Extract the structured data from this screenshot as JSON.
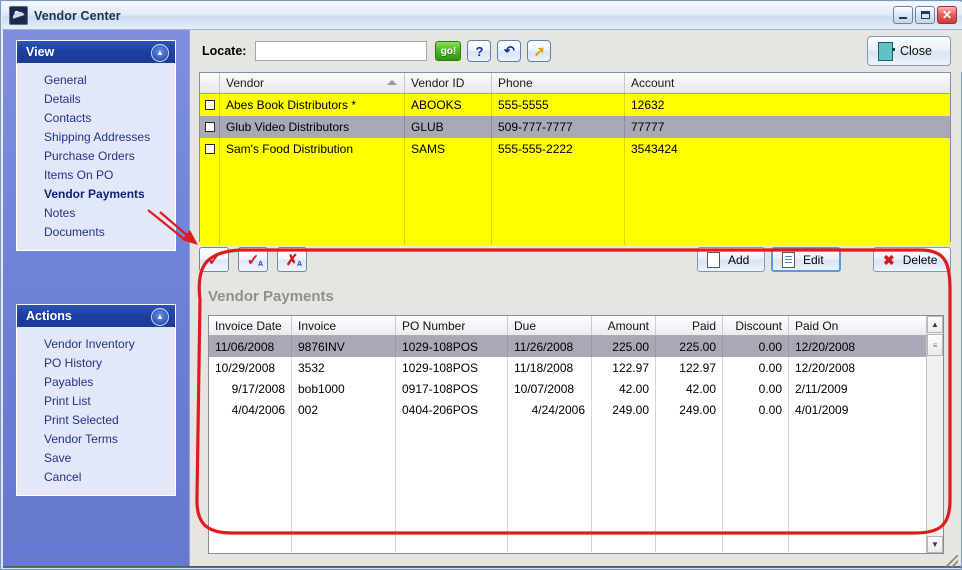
{
  "window": {
    "title": "Vendor Center",
    "icon": "app-swoosh-icon",
    "minimize_label": "_",
    "maximize_label": "□",
    "close_label": "✕"
  },
  "sidebar": {
    "groups": [
      {
        "title": "View",
        "collapse_icon": "chevron-up-icon",
        "items": [
          {
            "label": "General",
            "selected": false
          },
          {
            "label": "Details",
            "selected": false
          },
          {
            "label": "Contacts",
            "selected": false
          },
          {
            "label": "Shipping Addresses",
            "selected": false
          },
          {
            "label": "Purchase Orders",
            "selected": false
          },
          {
            "label": "Items On PO",
            "selected": false
          },
          {
            "label": "Vendor Payments",
            "selected": true
          },
          {
            "label": "Notes",
            "selected": false
          },
          {
            "label": "Documents",
            "selected": false
          }
        ]
      },
      {
        "title": "Actions",
        "collapse_icon": "chevron-up-icon",
        "items": [
          {
            "label": "Vendor Inventory",
            "selected": false
          },
          {
            "label": "PO History",
            "selected": false
          },
          {
            "label": "Payables",
            "selected": false
          },
          {
            "label": "Print List",
            "selected": false
          },
          {
            "label": "Print Selected",
            "selected": false
          },
          {
            "label": "Vendor Terms",
            "selected": false
          },
          {
            "label": "Save",
            "selected": false
          },
          {
            "label": "Cancel",
            "selected": false
          }
        ]
      }
    ]
  },
  "toolbar": {
    "locate_label": "Locate:",
    "locate_value": "",
    "locate_placeholder": "",
    "go_label": "go!",
    "help_label": "?",
    "refresh_label": "↵",
    "export_label": "↗",
    "close_label": "Close"
  },
  "vendor_grid": {
    "columns": [
      "",
      "Vendor",
      "Vendor ID",
      "Phone",
      "Account"
    ],
    "sorted_column": "Vendor",
    "sort_direction": "ascending",
    "rows": [
      {
        "checked": false,
        "vendor": "Abes Book Distributors *",
        "vendor_id": "ABOOKS",
        "phone": "555-5555",
        "account": "12632",
        "style": "yellow"
      },
      {
        "checked": false,
        "vendor": "Glub Video Distributors",
        "vendor_id": "GLUB",
        "phone": "509-777-7777",
        "account": "77777",
        "style": "selected"
      },
      {
        "checked": false,
        "vendor": "Sam's Food Distribution",
        "vendor_id": "SAMS",
        "phone": "555-555-2222",
        "account": "3543424",
        "style": "yellow"
      }
    ]
  },
  "grid_actions": {
    "check_all": "check-icon",
    "check_all_a": "check-a-icon",
    "uncheck_all_a": "uncheck-a-icon",
    "add_label": "Add",
    "edit_label": "Edit",
    "delete_label": "Delete"
  },
  "payments_panel": {
    "title": "Vendor Payments",
    "columns": [
      "Invoice Date",
      "Invoice",
      "PO Number",
      "Due",
      "Amount",
      "Paid",
      "Discount",
      "Paid On"
    ],
    "rows": [
      {
        "invoice_date": "11/06/2008",
        "invoice": "9876INV",
        "po_number": "1029-108POS",
        "due": "11/26/2008",
        "amount": "225.00",
        "paid": "225.00",
        "discount": "0.00",
        "paid_on": "12/20/2008",
        "selected": true
      },
      {
        "invoice_date": "10/29/2008",
        "invoice": "3532",
        "po_number": "1029-108POS",
        "due": "11/18/2008",
        "amount": "122.97",
        "paid": "122.97",
        "discount": "0.00",
        "paid_on": "12/20/2008",
        "selected": false
      },
      {
        "invoice_date": "9/17/2008",
        "invoice": "bob1000",
        "po_number": "0917-108POS",
        "due": "10/07/2008",
        "amount": "42.00",
        "paid": "42.00",
        "discount": "0.00",
        "paid_on": "2/11/2009",
        "selected": false
      },
      {
        "invoice_date": "4/04/2006",
        "invoice": "002",
        "po_number": "0404-206POS",
        "due": "4/24/2006",
        "amount": "249.00",
        "paid": "249.00",
        "discount": "0.00",
        "paid_on": "4/01/2009",
        "selected": false
      }
    ],
    "scroll_up": "scroll-up-icon",
    "scroll_down": "scroll-down-icon"
  },
  "annotation": {
    "color": "#e01b1b",
    "shape": "rounded-oval-callout",
    "points_from": "Vendor Payments",
    "points_to": "Vendor Payments panel"
  }
}
